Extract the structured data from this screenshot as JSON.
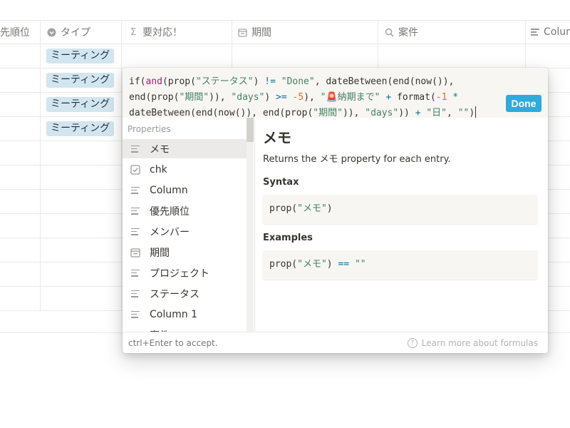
{
  "table": {
    "columns": [
      {
        "label": "先順位",
        "icon": "text-lines-icon"
      },
      {
        "label": "タイプ",
        "icon": "select-icon"
      },
      {
        "label": "要対応！",
        "icon": "sigma-icon"
      },
      {
        "label": "期間",
        "icon": "calendar-icon"
      },
      {
        "label": "案件",
        "icon": "search-icon"
      },
      {
        "label": "Colum",
        "icon": "text-lines-icon"
      }
    ],
    "type_tags": [
      "ミーティング",
      "ミーティング",
      "ミーティング",
      "ミーティング"
    ]
  },
  "formula_editor": {
    "lines": [
      [
        {
          "t": "if(",
          "c": "c-fn"
        },
        {
          "t": "and",
          "c": "c-kw"
        },
        {
          "t": "(prop(",
          "c": "c-fn"
        },
        {
          "t": "\"ステータス\"",
          "c": "c-str"
        },
        {
          "t": ") ",
          "c": "c-fn"
        },
        {
          "t": "!=",
          "c": "c-op"
        },
        {
          "t": " ",
          "c": "c-fn"
        },
        {
          "t": "\"Done\"",
          "c": "c-str"
        },
        {
          "t": ", dateBetween(end(now()),",
          "c": "c-fn"
        }
      ],
      [
        {
          "t": "end(prop(",
          "c": "c-fn"
        },
        {
          "t": "\"期間\"",
          "c": "c-str"
        },
        {
          "t": ")), ",
          "c": "c-fn"
        },
        {
          "t": "\"days\"",
          "c": "c-str"
        },
        {
          "t": ") ",
          "c": "c-fn"
        },
        {
          "t": ">=",
          "c": "c-op"
        },
        {
          "t": " ",
          "c": "c-fn"
        },
        {
          "t": "-5",
          "c": "c-num"
        },
        {
          "t": "), ",
          "c": "c-fn"
        },
        {
          "t": "\"🚨納期まで\"",
          "c": "c-str"
        },
        {
          "t": " ",
          "c": "c-fn"
        },
        {
          "t": "+",
          "c": "c-op"
        },
        {
          "t": " format(",
          "c": "c-fn"
        },
        {
          "t": "-1",
          "c": "c-num"
        },
        {
          "t": " ",
          "c": "c-fn"
        },
        {
          "t": "*",
          "c": "c-op"
        }
      ],
      [
        {
          "t": "dateBetween(end(now()), end(prop(",
          "c": "c-fn"
        },
        {
          "t": "\"期間\"",
          "c": "c-str"
        },
        {
          "t": ")), ",
          "c": "c-fn"
        },
        {
          "t": "\"days\"",
          "c": "c-str"
        },
        {
          "t": ")) ",
          "c": "c-fn"
        },
        {
          "t": "+",
          "c": "c-op"
        },
        {
          "t": " ",
          "c": "c-fn"
        },
        {
          "t": "\"日\"",
          "c": "c-str"
        },
        {
          "t": ", ",
          "c": "c-fn"
        },
        {
          "t": "\"\"",
          "c": "c-str"
        },
        {
          "t": ")",
          "c": "c-fn"
        }
      ]
    ],
    "done_label": "Done"
  },
  "properties_panel": {
    "title": "Properties",
    "items": [
      {
        "label": "メモ",
        "icon": "text-lines-icon",
        "selected": true
      },
      {
        "label": "chk",
        "icon": "checkbox-icon"
      },
      {
        "label": "Column",
        "icon": "text-lines-icon"
      },
      {
        "label": "優先順位",
        "icon": "text-lines-icon"
      },
      {
        "label": "メンバー",
        "icon": "text-lines-icon"
      },
      {
        "label": "期間",
        "icon": "calendar-icon"
      },
      {
        "label": "プロジェクト",
        "icon": "text-lines-icon"
      },
      {
        "label": "ステータス",
        "icon": "text-lines-icon"
      },
      {
        "label": "Column 1",
        "icon": "text-lines-icon"
      },
      {
        "label": "案件",
        "icon": "text-lines-icon"
      }
    ]
  },
  "doc": {
    "title": "メモ",
    "description": "Returns the メモ property for each entry.",
    "syntax_heading": "Syntax",
    "syntax_code": "prop(\"メモ\")",
    "examples_heading": "Examples",
    "example_code": "prop(\"メモ\") == \"\""
  },
  "footer": {
    "hint": "ctrl+Enter to accept.",
    "learn_more": "Learn more about formulas"
  }
}
